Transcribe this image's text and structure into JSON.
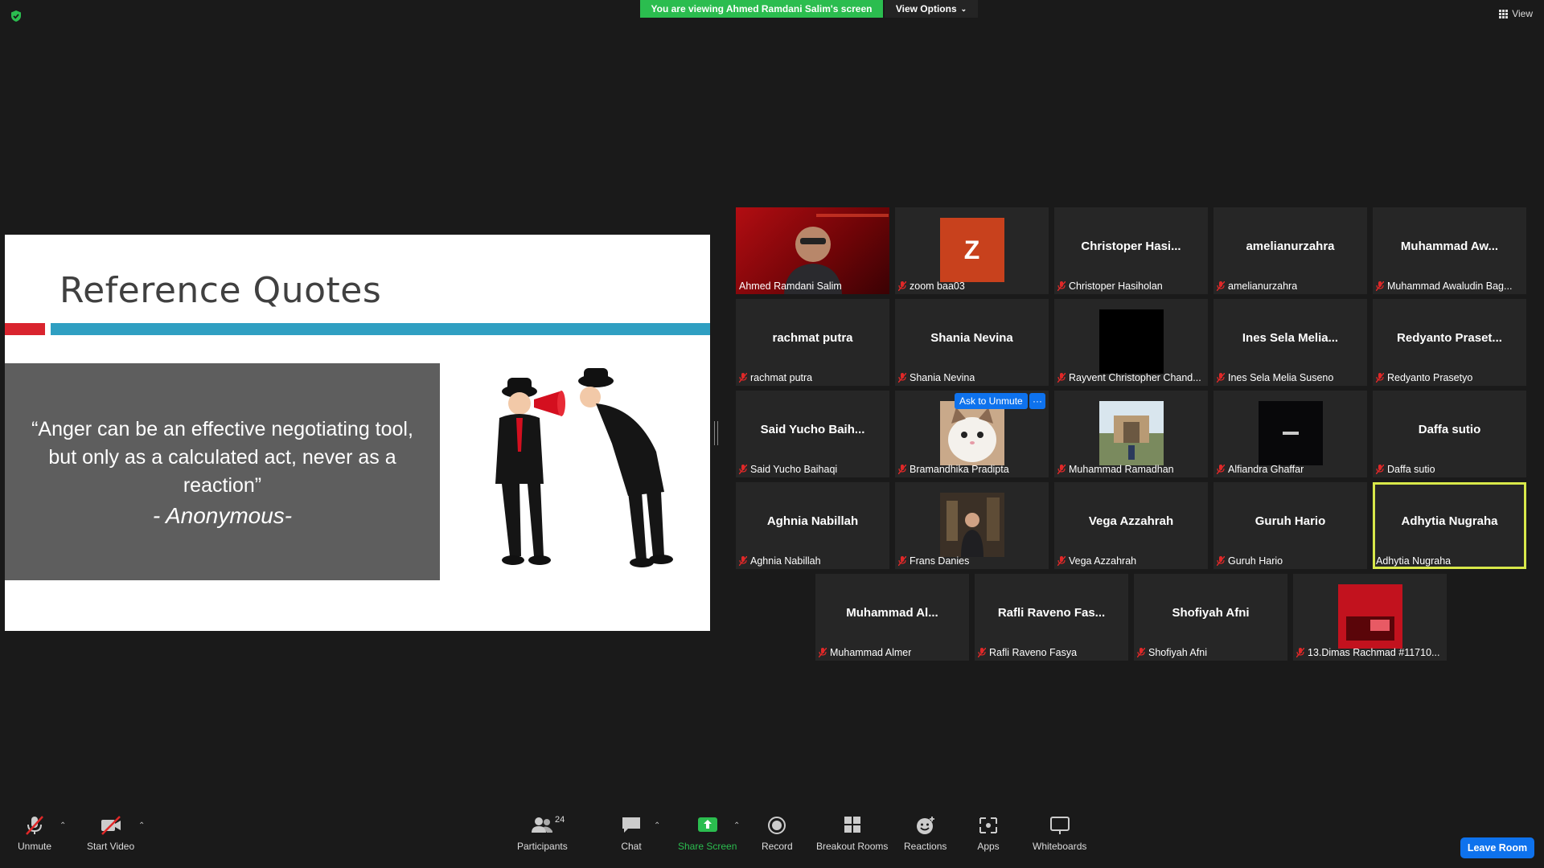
{
  "top_bar": {
    "viewing_banner": "You are viewing Ahmed Ramdani Salim's screen",
    "view_options": "View Options",
    "view": "View"
  },
  "slide": {
    "title": "Reference Quotes",
    "quote": "“Anger can be an effective negotiating tool, but only as a calculated act, never as a reaction”",
    "author": "- Anonymous-"
  },
  "participants": [
    {
      "label": "Ahmed Ramdani Salim",
      "display": "",
      "type": "video",
      "muted": false
    },
    {
      "label": "zoom baa03",
      "display": "Z",
      "type": "avatar",
      "muted": true
    },
    {
      "label": "Christoper Hasiholan",
      "display": "Christoper  Hasi...",
      "type": "name",
      "muted": true
    },
    {
      "label": "amelianurzahra",
      "display": "amelianurzahra",
      "type": "name",
      "muted": true
    },
    {
      "label": "Muhammad Awaludin Bag...",
      "display": "Muhammad  Aw...",
      "type": "name",
      "muted": true
    },
    {
      "label": "rachmat putra",
      "display": "rachmat putra",
      "type": "name",
      "muted": true
    },
    {
      "label": "Shania Nevina",
      "display": "Shania Nevina",
      "type": "name",
      "muted": true
    },
    {
      "label": "Rayvent Christopher Chand...",
      "display": "",
      "type": "black",
      "muted": true
    },
    {
      "label": "Ines Sela Melia Suseno",
      "display": "Ines  Sela  Melia...",
      "type": "name",
      "muted": true
    },
    {
      "label": "Redyanto Prasetyo",
      "display": "Redyanto  Praset...",
      "type": "name",
      "muted": true
    },
    {
      "label": "Said Yucho Baihaqi",
      "display": "Said  Yucho  Baih...",
      "type": "name",
      "muted": true
    },
    {
      "label": "Bramandhika Pradipta",
      "display": "",
      "type": "cat",
      "muted": true
    },
    {
      "label": "Muhammad Ramadhan",
      "display": "",
      "type": "building",
      "muted": true
    },
    {
      "label": "Alfiandra Ghaffar",
      "display": "",
      "type": "dark-logo",
      "muted": true
    },
    {
      "label": "Daffa sutio",
      "display": "Daffa sutio",
      "type": "name",
      "muted": true
    },
    {
      "label": "Aghnia Nabillah",
      "display": "Aghnia Nabillah",
      "type": "name",
      "muted": true
    },
    {
      "label": "Frans Danies",
      "display": "",
      "type": "night",
      "muted": true
    },
    {
      "label": "Vega Azzahrah",
      "display": "Vega Azzahrah",
      "type": "name",
      "muted": true
    },
    {
      "label": "Guruh Hario",
      "display": "Guruh Hario",
      "type": "name",
      "muted": true
    },
    {
      "label": "Adhytia Nugraha",
      "display": "Adhytia Nugraha",
      "type": "name",
      "muted": false,
      "active": true
    },
    {
      "label": "Muhammad Almer",
      "display": "Muhammad  Al...",
      "type": "name",
      "muted": true
    },
    {
      "label": "Rafli Raveno Fasya",
      "display": "Rafli  Raveno  Fas...",
      "type": "name",
      "muted": true
    },
    {
      "label": "Shofiyah Afni",
      "display": "Shofiyah Afni",
      "type": "name",
      "muted": true
    },
    {
      "label": "13.Dimas Rachmad #11710...",
      "display": "",
      "type": "red-room",
      "muted": true
    }
  ],
  "hover_menu": {
    "ask_unmute": "Ask to Unmute",
    "more": "···"
  },
  "toolbar": {
    "unmute": "Unmute",
    "start_video": "Start Video",
    "participants": "Participants",
    "participants_count": "24",
    "chat": "Chat",
    "share_screen": "Share Screen",
    "record": "Record",
    "breakout_rooms": "Breakout Rooms",
    "reactions": "Reactions",
    "apps": "Apps",
    "whiteboards": "Whiteboards",
    "leave_room": "Leave Room"
  },
  "colors": {
    "banner_green": "#2bbd4f",
    "accent_blue": "#0e72ed",
    "active_speaker": "#d8e84a",
    "mute_red": "#e02828"
  }
}
